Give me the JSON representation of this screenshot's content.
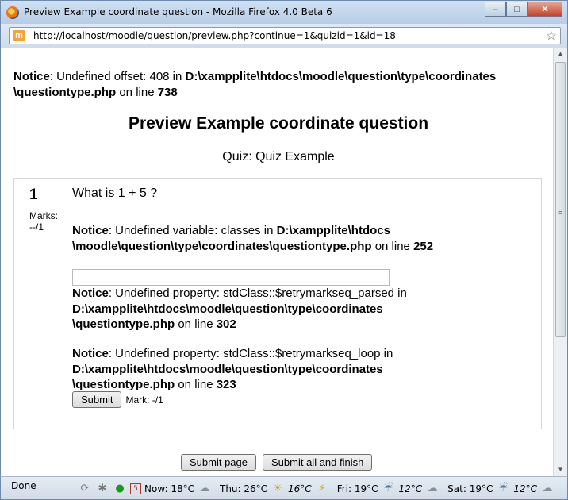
{
  "window": {
    "title": "Preview Example coordinate question - Mozilla Firefox 4.0 Beta 6",
    "minimize": "–",
    "maximize": "□",
    "close": "✕"
  },
  "address": {
    "url": "http://localhost/moodle/question/preview.php?continue=1&quizid=1&id=18",
    "site_icon_letter": "m"
  },
  "page": {
    "top_notice": {
      "label": "Notice",
      "text": ": Undefined offset: 408 in ",
      "path": "D:\\xampplite\\htdocs\\moodle\\question\\type\\coordinates \\questiontype.php",
      "on_line": " on line ",
      "line": "738"
    },
    "heading": "Preview Example coordinate question",
    "quiz": "Quiz: Quiz Example"
  },
  "question": {
    "number": "1",
    "marks_label": "Marks:",
    "marks_value": "--/1",
    "text": "What is 1 + 5 ?",
    "notices": [
      {
        "label": "Notice",
        "text": ": Undefined variable: classes in ",
        "path": "D:\\xampplite\\htdocs \\moodle\\question\\type\\coordinates\\questiontype.php",
        "on_line": " on line ",
        "line": "252"
      },
      {
        "label": "Notice",
        "text": ": Undefined property: stdClass::$retrymarkseq_parsed in ",
        "path": "D:\\xampplite\\htdocs\\moodle\\question\\type\\coordinates \\questiontype.php",
        "on_line": " on line ",
        "line": "302"
      },
      {
        "label": "Notice",
        "text": ": Undefined property: stdClass::$retrymarkseq_loop in ",
        "path": "D:\\xampplite\\htdocs\\moodle\\question\\type\\coordinates \\questiontype.php",
        "on_line": " on line ",
        "line": "323"
      }
    ],
    "answer_value": "",
    "submit_label": "Submit",
    "mark_text": "Mark: -/1"
  },
  "footer_buttons": {
    "submit_page": "Submit page",
    "submit_all": "Submit all and finish"
  },
  "statusbar": {
    "status": "Done",
    "calendar_day": "5",
    "now": "Now: 18°C",
    "thu": "Thu: 26°C",
    "thu_low": "16°C",
    "fri": "Fri: 19°C",
    "fri_low": "12°C",
    "sat": "Sat: 19°C",
    "sat_low": "12°C"
  }
}
